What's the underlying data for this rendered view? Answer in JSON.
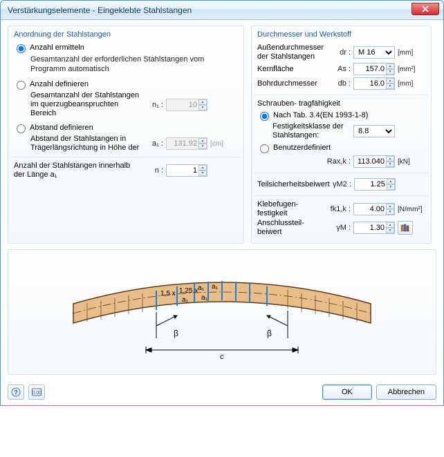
{
  "window": {
    "title": "Verstärkungselemente - Eingeklebte Stahlstangen"
  },
  "left": {
    "title": "Anordnung der Stahlstangen",
    "opt1_label": "Anzahl ermitteln",
    "opt1_desc": "Gesamtanzahl der erforderlichen Stahlstangen vom Programm automatisch",
    "opt2_label": "Anzahl definieren",
    "opt2_desc": "Gesamtanzahl der Stahlstangen im querzugbeanspruchten Bereich",
    "n1_sym": "n₁ :",
    "n1_value": "10",
    "opt3_label": "Abstand definieren",
    "opt3_desc": "Abstand der Stahlstangen in Trägerlängsrichtung in Höhe der",
    "a1_sym": "a₁ :",
    "a1_value": "131.92",
    "a1_unit": "[cm]",
    "count_label": "Anzahl der Stahlstangen innerhalb der Länge a₁",
    "n_sym": "n :",
    "n_value": "1"
  },
  "right": {
    "title": "Durchmesser und Werkstoff",
    "outer_label": "Außendurchmesser der Stahlstangen",
    "dr_sym": "dr :",
    "dr_value": "M 16",
    "dr_unit": "[mm]",
    "core_label": "Kernfläche",
    "as_sym": "As :",
    "as_value": "157.0",
    "as_unit": "[mm²]",
    "bore_label": "Bohrdurchmesser",
    "db_sym": "db :",
    "db_value": "16.0",
    "db_unit": "[mm]",
    "screw_title": "Schrauben- tragfähigkeit",
    "opt_tab_label": "Nach Tab. 3.4(EN 1993-1-8)",
    "strength_label": "Festigkeitsklasse der Stahlstangen:",
    "strength_value": "8.8",
    "opt_user_label": "Benutzerdefiniert",
    "rax_sym": "Rax,k :",
    "rax_value": "113.040",
    "rax_unit": "[kN]",
    "partial_label": "Teilsicherheitsbeiwert",
    "ym2_sym": "γM2 :",
    "ym2_value": "1.25",
    "glue_label": "Klebefugen-festigkeit",
    "fk1_sym": "fk1,k :",
    "fk1_value": "4.00",
    "fk1_unit": "[N/mm²]",
    "conn_label": "Anschlussteil-beiwert",
    "ym_sym": "γM :",
    "ym_value": "1.30"
  },
  "diagram": {
    "a1": "a₁",
    "a1b": "a₁",
    "a1c": "a₁",
    "a1d": "a₁",
    "x15": "1,5 x",
    "x125": "1,25 x",
    "beta1": "β",
    "beta2": "β",
    "c": "c"
  },
  "footer": {
    "ok": "OK",
    "cancel": "Abbrechen"
  }
}
